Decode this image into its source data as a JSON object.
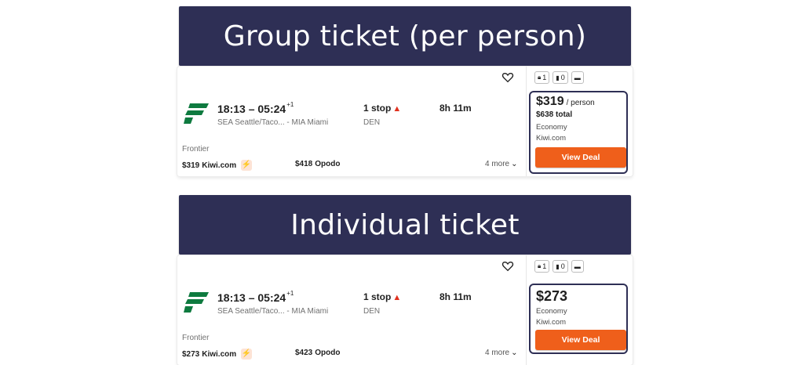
{
  "accent": "#ef5f1b",
  "banner_color": "#2e2f55",
  "panels": [
    {
      "banner": "Group ticket (per person)",
      "airline": "Frontier",
      "times": "18:13 – 05:24",
      "day_offset": "+1",
      "origin": "SEA Seattle/Taco...",
      "separator": "-",
      "destination": "MIA Miami",
      "stops": "1 stop",
      "layover": "DEN",
      "duration": "8h 11m",
      "bags": [
        {
          "icon": "personal-bag-icon",
          "count": "1"
        },
        {
          "icon": "carry-on-icon",
          "count": "0"
        },
        {
          "icon": "card-icon",
          "count": ""
        }
      ],
      "deal_price": "$319",
      "deal_per": "/ person",
      "deal_total": "$638 total",
      "cabin": "Economy",
      "provider": "Kiwi.com",
      "button": "View Deal",
      "offers": [
        {
          "price": "$319",
          "site": "Kiwi.com"
        },
        {
          "price": "$418",
          "site": "Opodo"
        }
      ],
      "more": "4 more"
    },
    {
      "banner": "Individual ticket",
      "airline": "Frontier",
      "times": "18:13 – 05:24",
      "day_offset": "+1",
      "origin": "SEA Seattle/Taco...",
      "separator": "-",
      "destination": "MIA Miami",
      "stops": "1 stop",
      "layover": "DEN",
      "duration": "8h 11m",
      "bags": [
        {
          "icon": "personal-bag-icon",
          "count": "1"
        },
        {
          "icon": "carry-on-icon",
          "count": "0"
        },
        {
          "icon": "card-icon",
          "count": ""
        }
      ],
      "deal_price": "$273",
      "cabin": "Economy",
      "provider": "Kiwi.com",
      "button": "View Deal",
      "offers": [
        {
          "price": "$273",
          "site": "Kiwi.com"
        },
        {
          "price": "$423",
          "site": "Opodo"
        }
      ],
      "more": "4 more"
    }
  ]
}
